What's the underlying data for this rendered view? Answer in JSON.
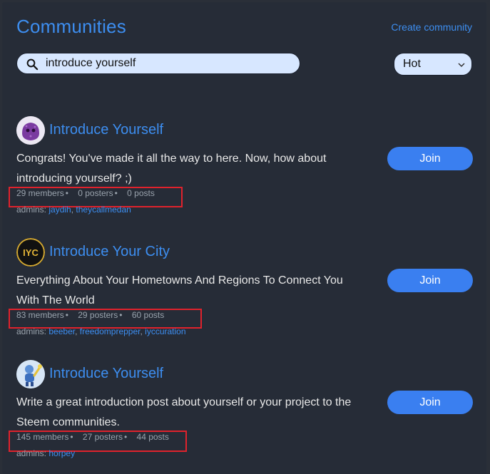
{
  "header": {
    "title": "Communities",
    "create_link": "Create community"
  },
  "search": {
    "value": "introduce yourself",
    "icon": "search-icon"
  },
  "sort": {
    "selected": "Hot"
  },
  "colors": {
    "accent": "#3d8ef0",
    "button": "#3a7ff0",
    "highlight": "#e0222c"
  },
  "communities": [
    {
      "name": "Introduce Yourself",
      "description": "Congrats! You've made it all the way to here. Now, how about introducing yourself? ;)",
      "members": "29 members",
      "posters": "0 posters",
      "posts": "0 posts",
      "admins_label": "admins:",
      "admins": [
        "jaydih",
        "theycallmedan"
      ],
      "join_label": "Join"
    },
    {
      "name": "Introduce Your City",
      "description": "Everything About Your Hometowns And Regions To Connect You With The World",
      "members": "83 members",
      "posters": "29 posters",
      "posts": "60 posts",
      "admins_label": "admins:",
      "admins": [
        "beeber",
        "freedomprepper",
        "iyccuration"
      ],
      "avatar_text": "IYC",
      "join_label": "Join"
    },
    {
      "name": "Introduce Yourself",
      "description": "Write a great introduction post about yourself or your project to the Steem communities.",
      "members": "145 members",
      "posters": "27 posters",
      "posts": "44 posts",
      "admins_label": "admins:",
      "admins": [
        "horpey"
      ],
      "join_label": "Join"
    }
  ]
}
